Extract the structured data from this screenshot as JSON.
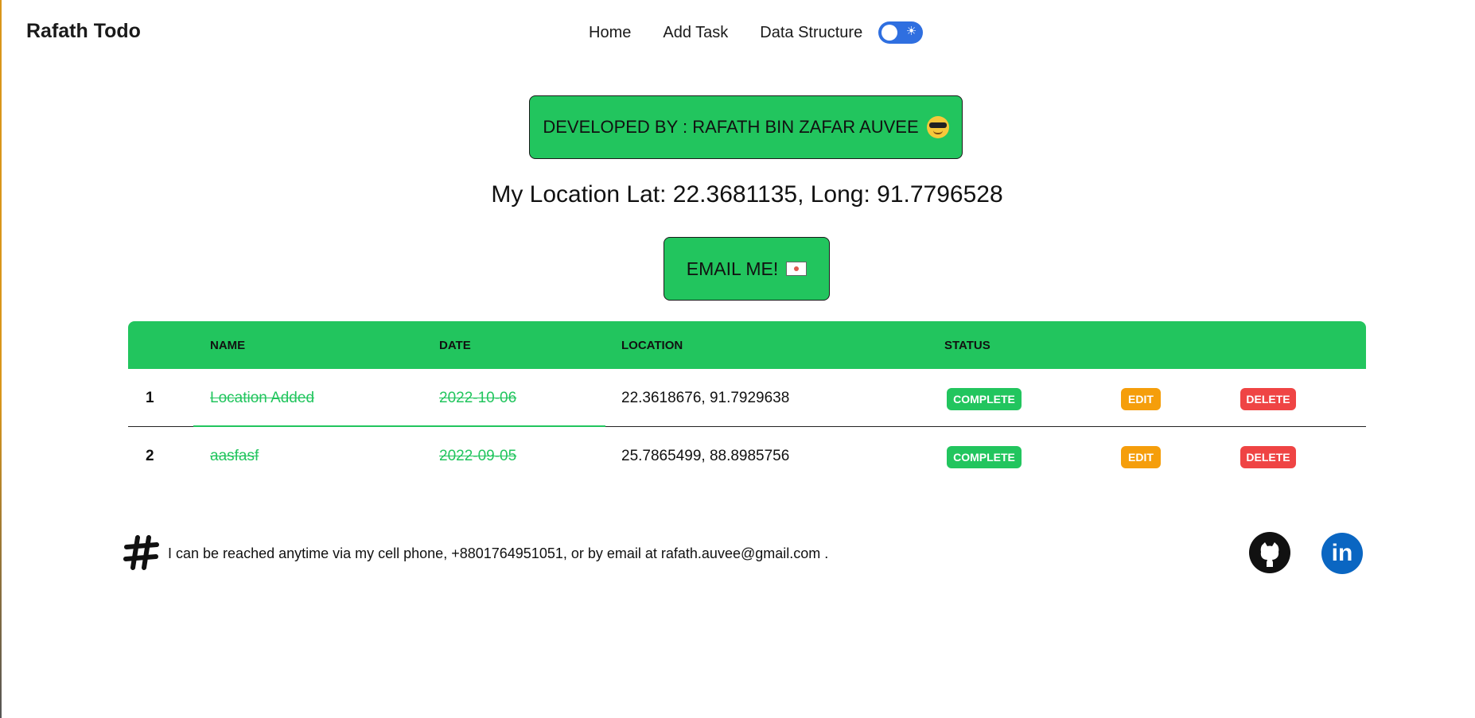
{
  "nav": {
    "brand": "Rafath Todo",
    "links": [
      "Home",
      "Add Task",
      "Data Structure"
    ],
    "theme_toggle_icon": "sun-icon"
  },
  "hero": {
    "developed_by": "DEVELOPED BY : RAFATH BIN ZAFAR AUVEE",
    "location": "My Location Lat: 22.3681135, Long: 91.7796528",
    "email_button": "EMAIL ME!"
  },
  "table": {
    "headers": [
      "NAME",
      "DATE",
      "LOCATION",
      "STATUS"
    ],
    "rows": [
      {
        "num": "1",
        "name": "Location Added",
        "date": "2022-10-06",
        "location": "22.3618676, 91.7929638",
        "status": "COMPLETE",
        "edit": "EDIT",
        "delete": "DELETE"
      },
      {
        "num": "2",
        "name": "aasfasf",
        "date": "2022-09-05",
        "location": "25.7865499, 88.8985756",
        "status": "COMPLETE",
        "edit": "EDIT",
        "delete": "DELETE"
      }
    ]
  },
  "footer": {
    "contact": "I can be reached anytime via my cell phone, +8801764951051, or by email at rafath.auvee@gmail.com  .",
    "icons": [
      "slack-hash-icon",
      "github-icon",
      "linkedin-icon"
    ]
  },
  "colors": {
    "accent_green": "#22c55e",
    "edit_orange": "#f59e0b",
    "delete_red": "#ef4444",
    "toggle_blue": "#2f6fe0",
    "linkedin_blue": "#0a66c2"
  }
}
